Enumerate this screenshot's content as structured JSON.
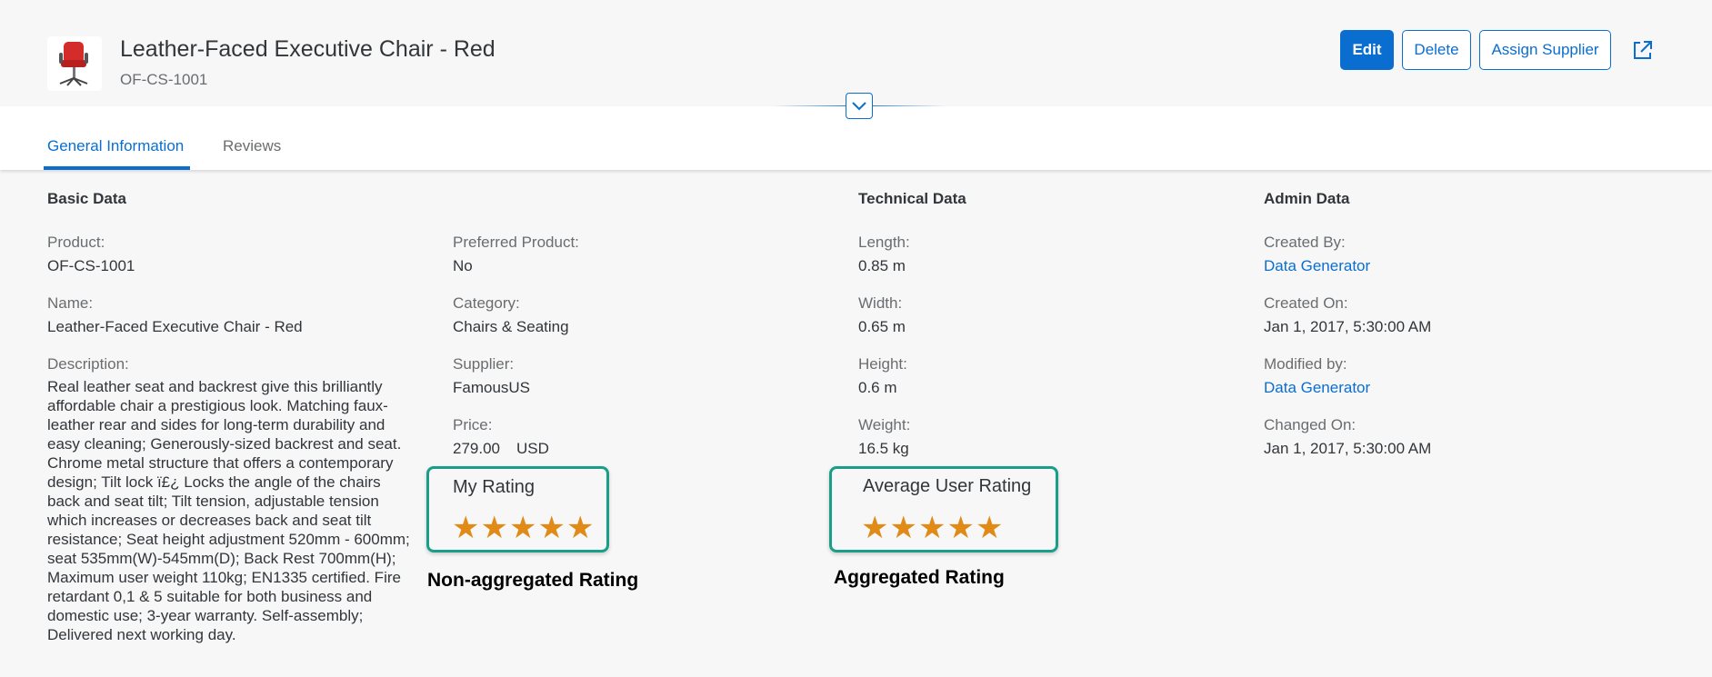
{
  "header": {
    "title": "Leather-Faced Executive Chair - Red",
    "subtitle": "OF-CS-1001",
    "actions": {
      "edit": "Edit",
      "delete": "Delete",
      "assign_supplier": "Assign Supplier"
    }
  },
  "tabs": [
    {
      "label": "General Information",
      "active": true
    },
    {
      "label": "Reviews",
      "active": false
    }
  ],
  "basic_data": {
    "title": "Basic Data",
    "product_label": "Product:",
    "product_value": "OF-CS-1001",
    "name_label": "Name:",
    "name_value": "Leather-Faced Executive Chair - Red",
    "description_label": "Description:",
    "description_value": "Real leather seat and backrest give this brilliantly affordable chair a prestigious look. Matching faux-leather rear and sides for long-term durability and easy cleaning; Generously-sized backrest and seat. Chrome metal structure that offers a contemporary design; Tilt lock ï£¿ Locks the angle of the chairs back and seat tilt; Tilt tension, adjustable tension which increases or decreases back and seat tilt resistance; Seat height adjustment 520mm - 600mm; seat 535mm(W)-545mm(D); Back Rest 700mm(H); Maximum user weight 110kg; EN1335 certified. Fire retardant 0,1 & 5 suitable for both business and domestic use; 3-year warranty. Self-assembly; Delivered next working day.",
    "preferred_label": "Preferred Product:",
    "preferred_value": "No",
    "category_label": "Category:",
    "category_value": "Chairs & Seating",
    "supplier_label": "Supplier:",
    "supplier_value": "FamousUS",
    "price_label": "Price:",
    "price_value": "279.00",
    "price_currency": "USD"
  },
  "technical_data": {
    "title": "Technical Data",
    "length_label": "Length:",
    "length_value": "0.85 m",
    "width_label": "Width:",
    "width_value": "0.65 m",
    "height_label": "Height:",
    "height_value": "0.6 m",
    "weight_label": "Weight:",
    "weight_value": "16.5 kg"
  },
  "admin_data": {
    "title": "Admin Data",
    "created_by_label": "Created By:",
    "created_by_value": "Data Generator",
    "created_on_label": "Created On:",
    "created_on_value": "Jan 1, 2017, 5:30:00 AM",
    "modified_by_label": "Modified by:",
    "modified_by_value": "Data Generator",
    "changed_on_label": "Changed On:",
    "changed_on_value": "Jan 1, 2017, 5:30:00 AM"
  },
  "ratings": {
    "my_rating_label": "My Rating",
    "my_rating_stars": 5,
    "my_rating_caption": "Non-aggregated Rating",
    "avg_rating_label": "Average User Rating",
    "avg_rating_stars": 5,
    "avg_rating_caption": "Aggregated Rating",
    "star_color": "#e08a18",
    "highlight_color": "#1a9e8a"
  },
  "colors": {
    "accent": "#0a6ed1",
    "text": "#32363a",
    "label": "#6a6d70"
  },
  "icons": {
    "share": "share-icon",
    "collapse": "chevron-down-icon",
    "product": "chair-thumbnail"
  }
}
